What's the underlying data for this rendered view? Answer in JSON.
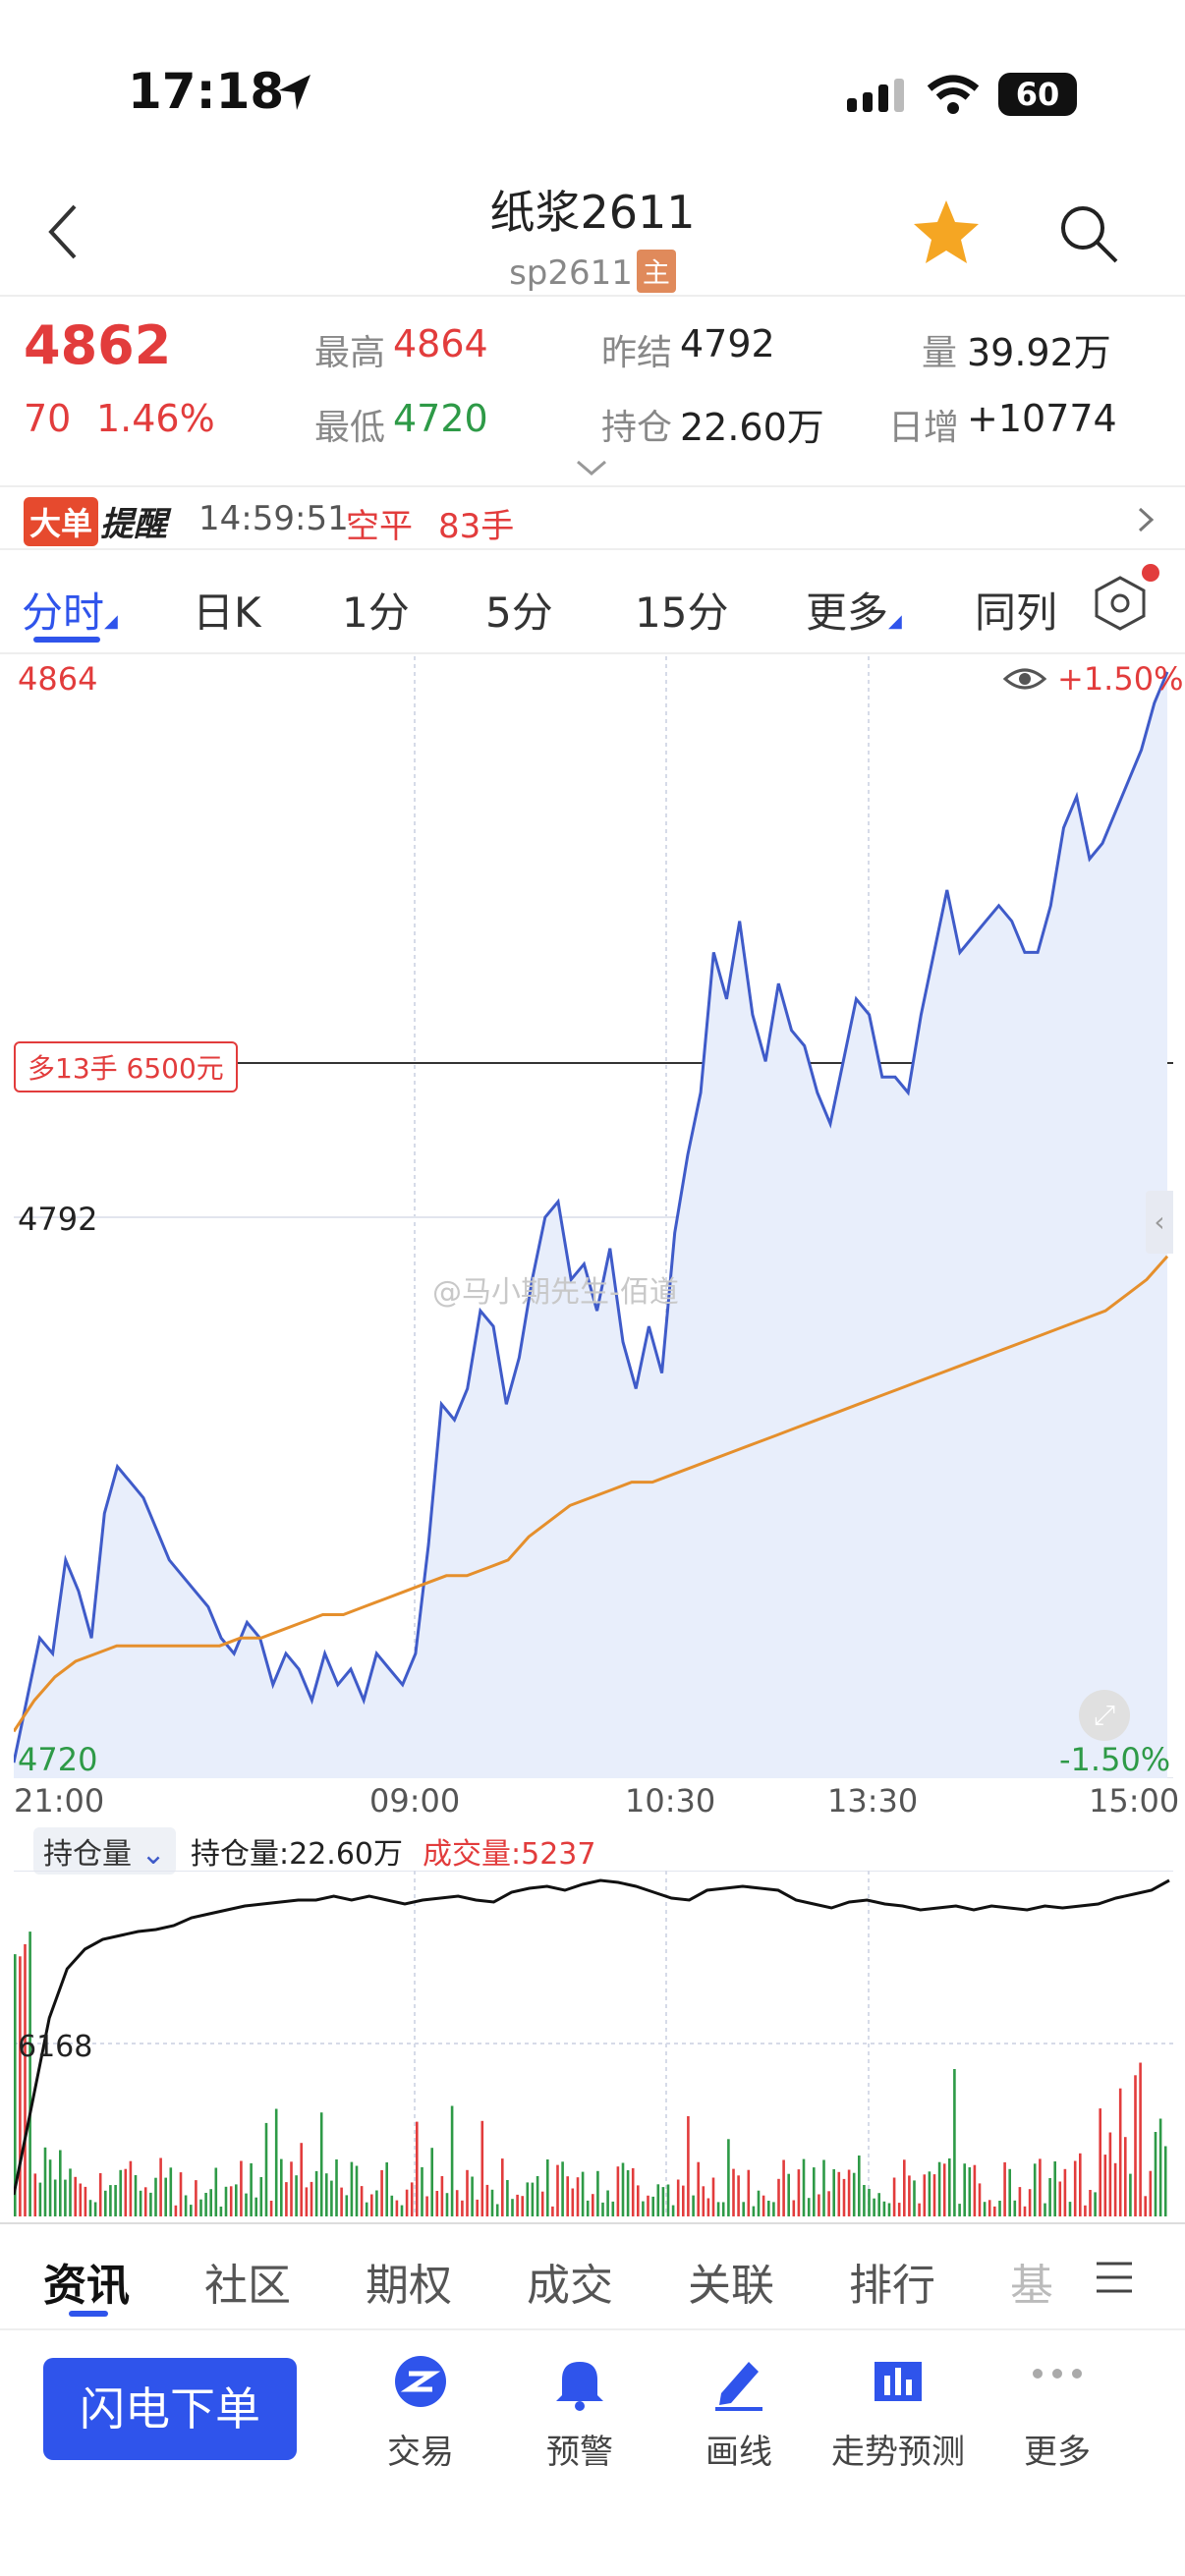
{
  "status_bar": {
    "time": "17:18",
    "battery": "60"
  },
  "header": {
    "title": "纸浆2611",
    "code": "sp2611",
    "main_badge": "主"
  },
  "quote": {
    "last": "4862",
    "change": "70",
    "change_pct": "1.46%",
    "high_label": "最高",
    "high": "4864",
    "low_label": "最低",
    "low": "4720",
    "prev_settle_label": "昨结",
    "prev_settle": "4792",
    "open_interest_label": "持仓",
    "open_interest": "22.60万",
    "volume_label": "量",
    "volume": "39.92万",
    "daily_inc_label": "日增",
    "daily_inc": "+10774"
  },
  "alert": {
    "badge": "大单",
    "badge_text": "提醒",
    "time": "14:59:51",
    "type": "空平",
    "size": "83手"
  },
  "tabs": [
    "分时",
    "日K",
    "1分",
    "5分",
    "15分",
    "更多",
    "同列"
  ],
  "chart": {
    "y_top": "4864",
    "y_mid": "4792",
    "y_bottom": "4720",
    "pct_top": "+1.50%",
    "pct_bottom": "-1.50%",
    "order_tag": "多13手 6500元",
    "x_labels": [
      "21:00",
      "09:00",
      "10:30",
      "13:30",
      "15:00"
    ],
    "watermark": "@马小期先生-佰道"
  },
  "chart_data": {
    "type": "line",
    "ylim": [
      4720,
      4864
    ],
    "series": [
      {
        "values": [
          4722,
          4730,
          4738,
          4736,
          4748,
          4744,
          4738,
          4754,
          4760,
          4758,
          4756,
          4752,
          4748,
          4746,
          4744,
          4742,
          4738,
          4736,
          4740,
          4738,
          4732,
          4736,
          4734,
          4730,
          4736,
          4732,
          4734,
          4730,
          4736,
          4734,
          4732,
          4736,
          4750,
          4768,
          4766,
          4770,
          4780,
          4778,
          4768,
          4774,
          4784,
          4792,
          4794,
          4784,
          4786,
          4780,
          4788,
          4776,
          4770,
          4778,
          4772,
          4790,
          4800,
          4808,
          4826,
          4820,
          4830,
          4818,
          4812,
          4822,
          4816,
          4814,
          4808,
          4804,
          4812,
          4820,
          4818,
          4810,
          4810,
          4808,
          4818,
          4826,
          4834,
          4826,
          4828,
          4830,
          4832,
          4830,
          4826,
          4826,
          4832,
          4842,
          4846,
          4838,
          4840,
          4844,
          4848,
          4852,
          4858,
          4862
        ]
      },
      {
        "values": [
          4726,
          4730,
          4733,
          4735,
          4736,
          4737,
          4737,
          4737,
          4737,
          4737,
          4737,
          4738,
          4738,
          4739,
          4740,
          4741,
          4741,
          4742,
          4743,
          4744,
          4745,
          4746,
          4746,
          4747,
          4748,
          4751,
          4753,
          4755,
          4756,
          4757,
          4758,
          4758,
          4759,
          4760,
          4761,
          4762,
          4763,
          4764,
          4765,
          4766,
          4767,
          4768,
          4769,
          4770,
          4771,
          4772,
          4773,
          4774,
          4775,
          4776,
          4777,
          4778,
          4779,
          4780,
          4782,
          4784,
          4787
        ]
      }
    ],
    "x": [
      "21:00",
      "09:00",
      "10:30",
      "13:30",
      "15:00"
    ]
  },
  "sub_chart": {
    "selector": "持仓量",
    "oi_label": "持仓量:22.60万",
    "vol_label": "成交量:5237",
    "y_label": "6168"
  },
  "bottom_tabs": [
    "资讯",
    "社区",
    "期权",
    "成交",
    "关联",
    "排行",
    "基"
  ],
  "actions": {
    "flash_order": "闪电下单",
    "items": [
      "交易",
      "预警",
      "画线",
      "走势预测",
      "更多"
    ]
  },
  "colors": {
    "up": "#e23c3c",
    "down": "#2e9a47",
    "price_line": "#3f5bc9",
    "avg_line": "#e58f2c",
    "accent": "#2f54eb"
  }
}
